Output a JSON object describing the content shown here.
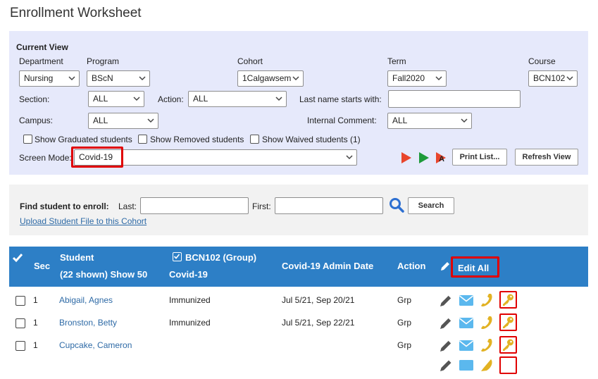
{
  "page": {
    "title": "Enrollment Worksheet"
  },
  "filters": {
    "current_view_label": "Current View",
    "department": {
      "label": "Department",
      "value": "Nursing"
    },
    "program": {
      "label": "Program",
      "value": "BScN"
    },
    "cohort": {
      "label": "Cohort",
      "value": "1Calgawsem"
    },
    "term": {
      "label": "Term",
      "value": "Fall2020"
    },
    "course": {
      "label": "Course",
      "value": "BCN102"
    },
    "section": {
      "label": "Section:",
      "value": "ALL"
    },
    "action": {
      "label": "Action:",
      "value": "ALL"
    },
    "last_name": {
      "label": "Last name starts with:",
      "value": ""
    },
    "campus": {
      "label": "Campus:",
      "value": "ALL"
    },
    "internal_comment": {
      "label": "Internal Comment:",
      "value": "ALL"
    },
    "show_graduated": "Show Graduated students",
    "show_removed": "Show Removed students",
    "show_waived": "Show Waived students (1)",
    "screen_mode": {
      "label": "Screen Mode:",
      "value": "Covid-19"
    },
    "print_button": "Print List...",
    "refresh_button": "Refresh View",
    "colors": {
      "play_red": "#e8452c",
      "play_green": "#1e9a3a"
    }
  },
  "find": {
    "label": "Find student to enroll:",
    "last_label": "Last:",
    "first_label": "First:",
    "search_button": "Search",
    "upload_link": "Upload Student File to this Cohort"
  },
  "table": {
    "header": {
      "sec": "Sec",
      "student": "Student",
      "shown": "(22 shown) Show 50",
      "course_group": "BCN102  (Group)",
      "covid": "Covid-19",
      "admin_date": "Covid-19 Admin Date",
      "action": "Action",
      "edit_all": "Edit All",
      "bg_color": "#2d7fc6"
    },
    "rows": [
      {
        "sec": "1",
        "student": "Abigail, Agnes",
        "covid": "Immunized",
        "admin_date": "Jul 5/21, Sep 20/21",
        "action": "Grp"
      },
      {
        "sec": "1",
        "student": "Bronston, Betty",
        "covid": "Immunized",
        "admin_date": "Jul 5/21, Sep 22/21",
        "action": "Grp"
      },
      {
        "sec": "1",
        "student": "Cupcake, Cameron",
        "covid": "",
        "admin_date": "",
        "action": "Grp"
      }
    ]
  }
}
